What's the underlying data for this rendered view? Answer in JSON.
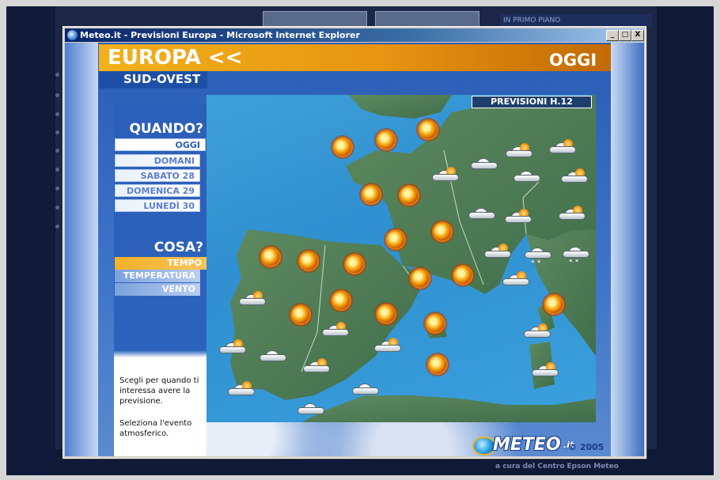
{
  "window": {
    "title": "Meteo.it - Previsioni Europa - Microsoft Internet Explorer",
    "minimize": "_",
    "maximize": "□",
    "close": "X"
  },
  "background": {
    "primo_piano": "IN PRIMO PIANO",
    "footer": "a cura del Centro Epson Meteo"
  },
  "header": {
    "title": "EUROPA <<",
    "day": "OGGI",
    "region": "SUD-OVEST"
  },
  "quando": {
    "title": "QUANDO?",
    "items": [
      {
        "label": "OGGI",
        "active": true
      },
      {
        "label": "DOMANI",
        "active": false
      },
      {
        "label": "SABATO 28",
        "active": false
      },
      {
        "label": "DOMENICA 29",
        "active": false
      },
      {
        "label": "LUNEDÌ 30",
        "active": false
      }
    ]
  },
  "cosa": {
    "title": "COSA?",
    "items": [
      {
        "label": "TEMPO",
        "active": true
      },
      {
        "label": "TEMPERATURA",
        "active": false
      },
      {
        "label": "VENTO",
        "active": false
      }
    ]
  },
  "help": {
    "line1": "Scegli per quando ti interessa avere la previsione.",
    "line2": "Seleziona l'evento atmosferico."
  },
  "map": {
    "forecast_label": "PREVISIONI H.12",
    "icons": {
      "sun": "sun-icon",
      "cloud": "cloud-icon",
      "partly_cloudy": "partly-cloudy-icon",
      "snow": "snow-icon"
    }
  },
  "logo": {
    "text": "METEO",
    "suffix": ".it",
    "copyright": "© 2005"
  },
  "colors": {
    "header_orange": "#e79512",
    "panel_blue": "#2c5fb8",
    "sea_blue": "#3498d6",
    "land_green": "#4d7a55"
  }
}
